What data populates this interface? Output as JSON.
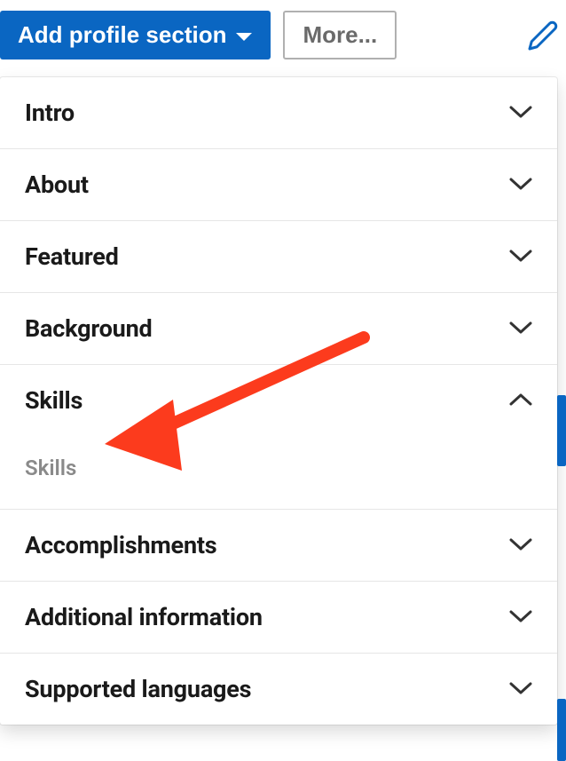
{
  "toolbar": {
    "add_section_label": "Add profile section",
    "more_label": "More..."
  },
  "colors": {
    "primary": "#0a66c2",
    "annotation": "#fc3b1d"
  },
  "sections": [
    {
      "label": "Intro",
      "expanded": false
    },
    {
      "label": "About",
      "expanded": false
    },
    {
      "label": "Featured",
      "expanded": false
    },
    {
      "label": "Background",
      "expanded": false
    },
    {
      "label": "Skills",
      "expanded": true,
      "subitems": [
        {
          "label": "Skills"
        }
      ]
    },
    {
      "label": "Accomplishments",
      "expanded": false
    },
    {
      "label": "Additional information",
      "expanded": false
    },
    {
      "label": "Supported languages",
      "expanded": false
    }
  ]
}
